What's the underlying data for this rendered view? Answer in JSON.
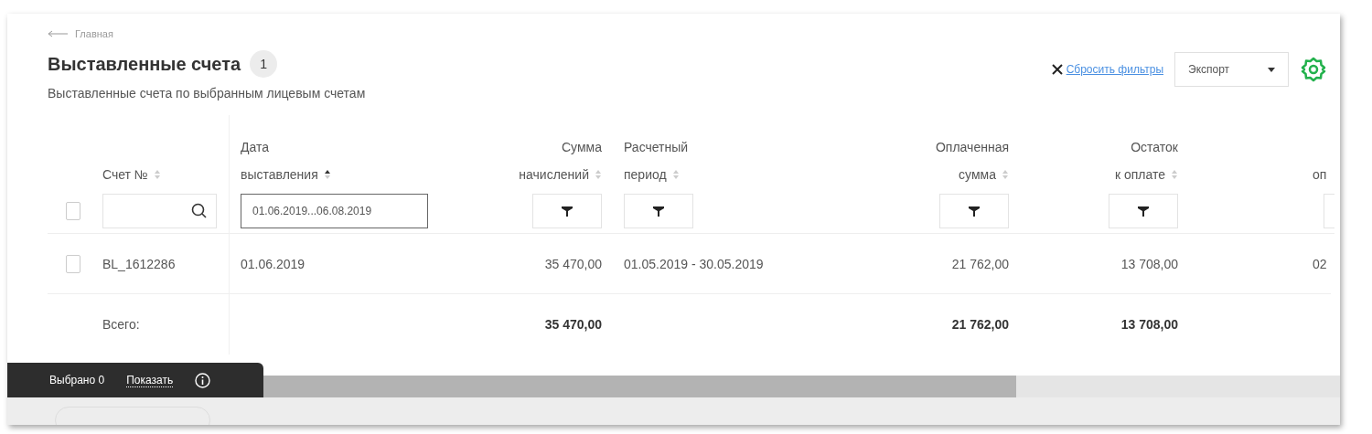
{
  "breadcrumb": {
    "label": "Главная"
  },
  "title": "Выставленные счета",
  "count": "1",
  "subtitle": "Выставленные счета по выбранным лицевым счетам",
  "toolbar": {
    "reset_filters": "Сбросить фильтры",
    "export": "Экспорт"
  },
  "table": {
    "header_checkbox": {
      "checked": false
    },
    "columns": [
      {
        "lines": [
          "Счет №"
        ],
        "align_right": false,
        "sort_active": false,
        "filter": {
          "kind": "search"
        }
      },
      {
        "lines": [
          "Дата",
          "выставления"
        ],
        "align_right": false,
        "sort_active": true,
        "filter": {
          "kind": "date",
          "value": "01.06.2019...06.08.2019"
        }
      },
      {
        "lines": [
          "Сумма",
          "начислений"
        ],
        "align_right": true,
        "sort_active": false,
        "filter": {
          "kind": "filter"
        }
      },
      {
        "lines": [
          "Расчетный",
          "период"
        ],
        "align_right": false,
        "sort_active": false,
        "filter": {
          "kind": "filter"
        }
      },
      {
        "lines": [
          "Оплаченная",
          "сумма"
        ],
        "align_right": true,
        "sort_active": false,
        "filter": {
          "kind": "filter"
        }
      },
      {
        "lines": [
          "Остаток",
          "к оплате"
        ],
        "align_right": true,
        "sort_active": false,
        "filter": {
          "kind": "filter"
        }
      },
      {
        "lines": [
          "оп"
        ],
        "align_right": false,
        "filter": {
          "kind": "clipped"
        }
      }
    ],
    "rows": [
      {
        "checked": false,
        "cells": [
          "BL_1612286",
          "01.06.2019",
          "35 470,00",
          "01.05.2019 - 30.05.2019",
          "21 762,00",
          "13 708,00",
          "02"
        ]
      }
    ],
    "totals": {
      "cells": [
        "Всего:",
        null,
        "35 470,00",
        null,
        "21 762,00",
        "13 708,00",
        null
      ]
    }
  },
  "selection_bar": {
    "selected": "Выбрано 0",
    "show": "Показать"
  }
}
